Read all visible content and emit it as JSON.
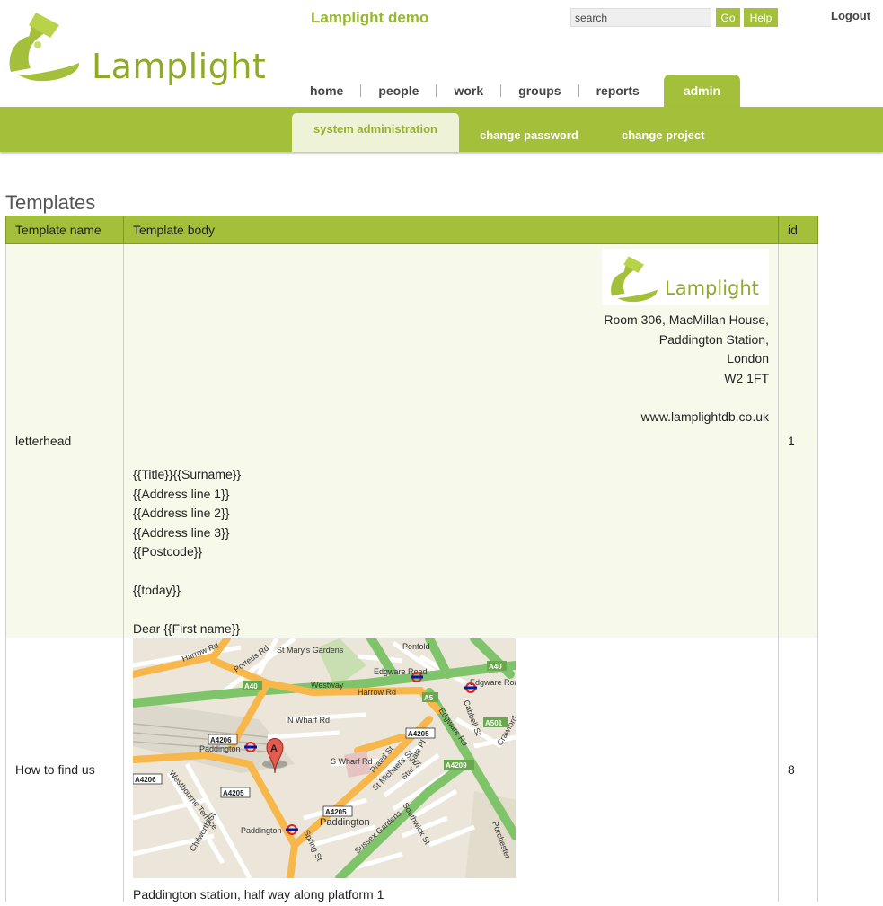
{
  "header": {
    "brand": "Lamplight",
    "project_title": "Lamplight demo",
    "search_placeholder": "search",
    "go_label": "Go",
    "help_label": "Help",
    "logout_label": "Logout"
  },
  "nav": {
    "tabs": [
      {
        "label": "home"
      },
      {
        "label": "people"
      },
      {
        "label": "work"
      },
      {
        "label": "groups"
      },
      {
        "label": "reports"
      },
      {
        "label": "admin",
        "active": true
      }
    ]
  },
  "subnav": {
    "items": [
      {
        "label": "system administration",
        "active": true
      },
      {
        "label": "change password"
      },
      {
        "label": "change project"
      }
    ]
  },
  "page": {
    "title": "Templates"
  },
  "table": {
    "columns": [
      "Template name",
      "Template body",
      "id"
    ],
    "rows": [
      {
        "name": "letterhead",
        "id": "1",
        "logo_text": "Lamplight",
        "address": [
          "Room 306, MacMillan House,",
          "Paddington Station,",
          "London",
          "W2 1FT",
          "",
          "www.lamplightdb.co.uk"
        ],
        "merge_fields": [
          "{{Title}}{{Surname}}",
          "{{Address line 1}}",
          "{{Address line 2}}",
          "{{Address line 3}}",
          "{{Postcode}}",
          "",
          "{{today}}",
          "",
          "Dear {{First name}}"
        ]
      },
      {
        "name": "How to find us",
        "id": "8",
        "map_labels": {
          "harrow_rd": "Harrow Rd",
          "westway": "Westway",
          "a40_a": "A40",
          "a40_b": "A40",
          "edgware_road_1": "Edgware Road",
          "edgware_road_2": "Edgware Road",
          "a5": "A5",
          "a501": "A501",
          "a4209": "A4209",
          "a4206_a": "A4206",
          "a4206_b": "A4206",
          "a4205_a": "A4205",
          "a4205_b": "A4205",
          "a4205_c": "A4205",
          "paddington_1": "Paddington",
          "paddington_2": "Paddington",
          "paddington_3": "Paddington",
          "praed_st": "Praed St",
          "edgware_rd": "Edgware Rd",
          "sussex_gardens": "Sussex Gardens",
          "westbourne_terrace": "Westbourne Terrace",
          "n_wharf_rd": "N Wharf Rd",
          "s_wharf_rd": "S Wharf Rd",
          "porteus_rd": "Porteus Rd",
          "st_marys": "St Mary's Gardens",
          "penfold": "Penfold",
          "cabbell_st": "Cabbell St",
          "crawford": "Crawford",
          "chilworth_st": "Chilworth St",
          "spring_st": "Spring St",
          "southwick_st": "Southwick St",
          "star_st": "Star St",
          "st_michaels_st": "St Michael's St",
          "sale_pl": "Sale Pl",
          "porchester": "Porchester",
          "marker": "A"
        },
        "caption": "Paddington station, half way along platform 1"
      }
    ]
  },
  "colors": {
    "brand_green": "#a4c03a",
    "light_green": "#f7faea"
  }
}
